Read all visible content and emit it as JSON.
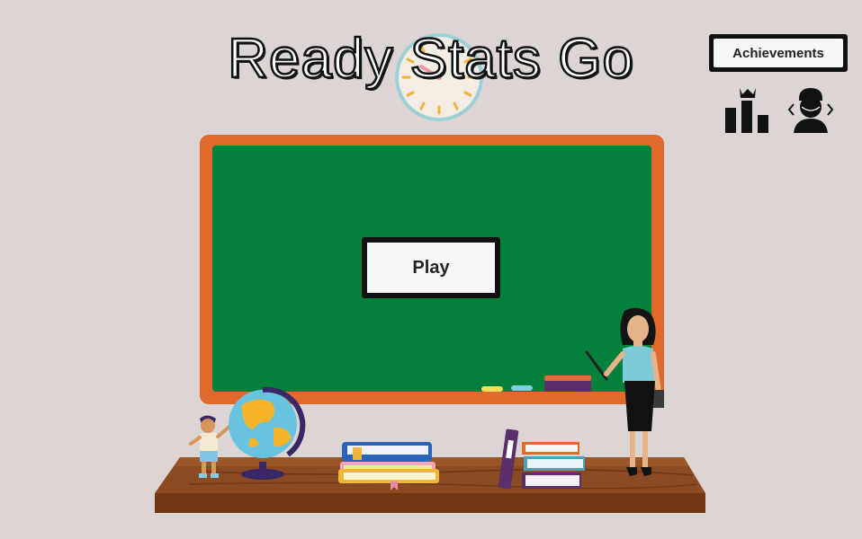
{
  "game": {
    "title": "Ready Stats Go"
  },
  "menu": {
    "play_label": "Play",
    "achievements_label": "Achievements"
  },
  "icons": {
    "leaderboard": "leaderboard-icon",
    "avatar": "avatar-select-icon",
    "clock": "clock-icon"
  },
  "colors": {
    "background": "#dcd5d3",
    "board_green": "#03803a",
    "board_frame": "#e06a2c",
    "desk": "#7a3f1c",
    "button_border": "#111111",
    "button_face": "#f7f7f7"
  }
}
